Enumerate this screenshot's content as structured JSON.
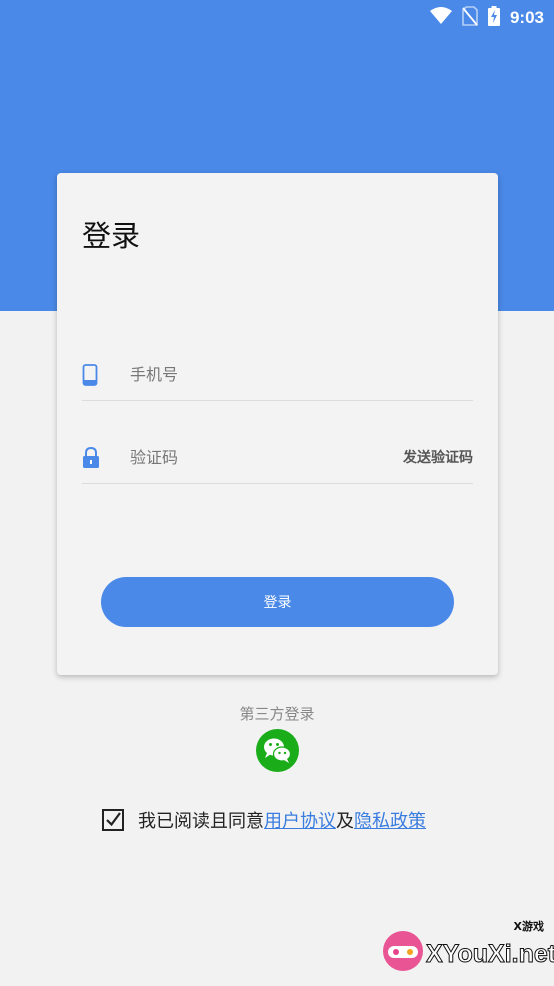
{
  "status_bar": {
    "time": "9:03",
    "icons": [
      "wifi-icon",
      "no-sim-icon",
      "battery-charging-icon"
    ]
  },
  "login_card": {
    "title": "登录",
    "phone_field": {
      "placeholder": "手机号",
      "value": "",
      "icon": "phone-icon"
    },
    "code_field": {
      "placeholder": "验证码",
      "value": "",
      "icon": "lock-icon"
    },
    "send_code_label": "发送验证码",
    "login_button_label": "登录"
  },
  "third_party": {
    "label": "第三方登录",
    "icon": "wechat-icon"
  },
  "agreement": {
    "checked": true,
    "prefix": "我已阅读且同意",
    "user_agreement": "用户协议",
    "conjunction": "及",
    "privacy_policy": "隐私政策"
  },
  "watermark": {
    "site": "XYouXi.net",
    "tag": "X游戏"
  },
  "colors": {
    "primary": "#4a89e8",
    "background": "#f2f2f2",
    "link": "#3a7de0",
    "wechat": "#1aad19"
  }
}
